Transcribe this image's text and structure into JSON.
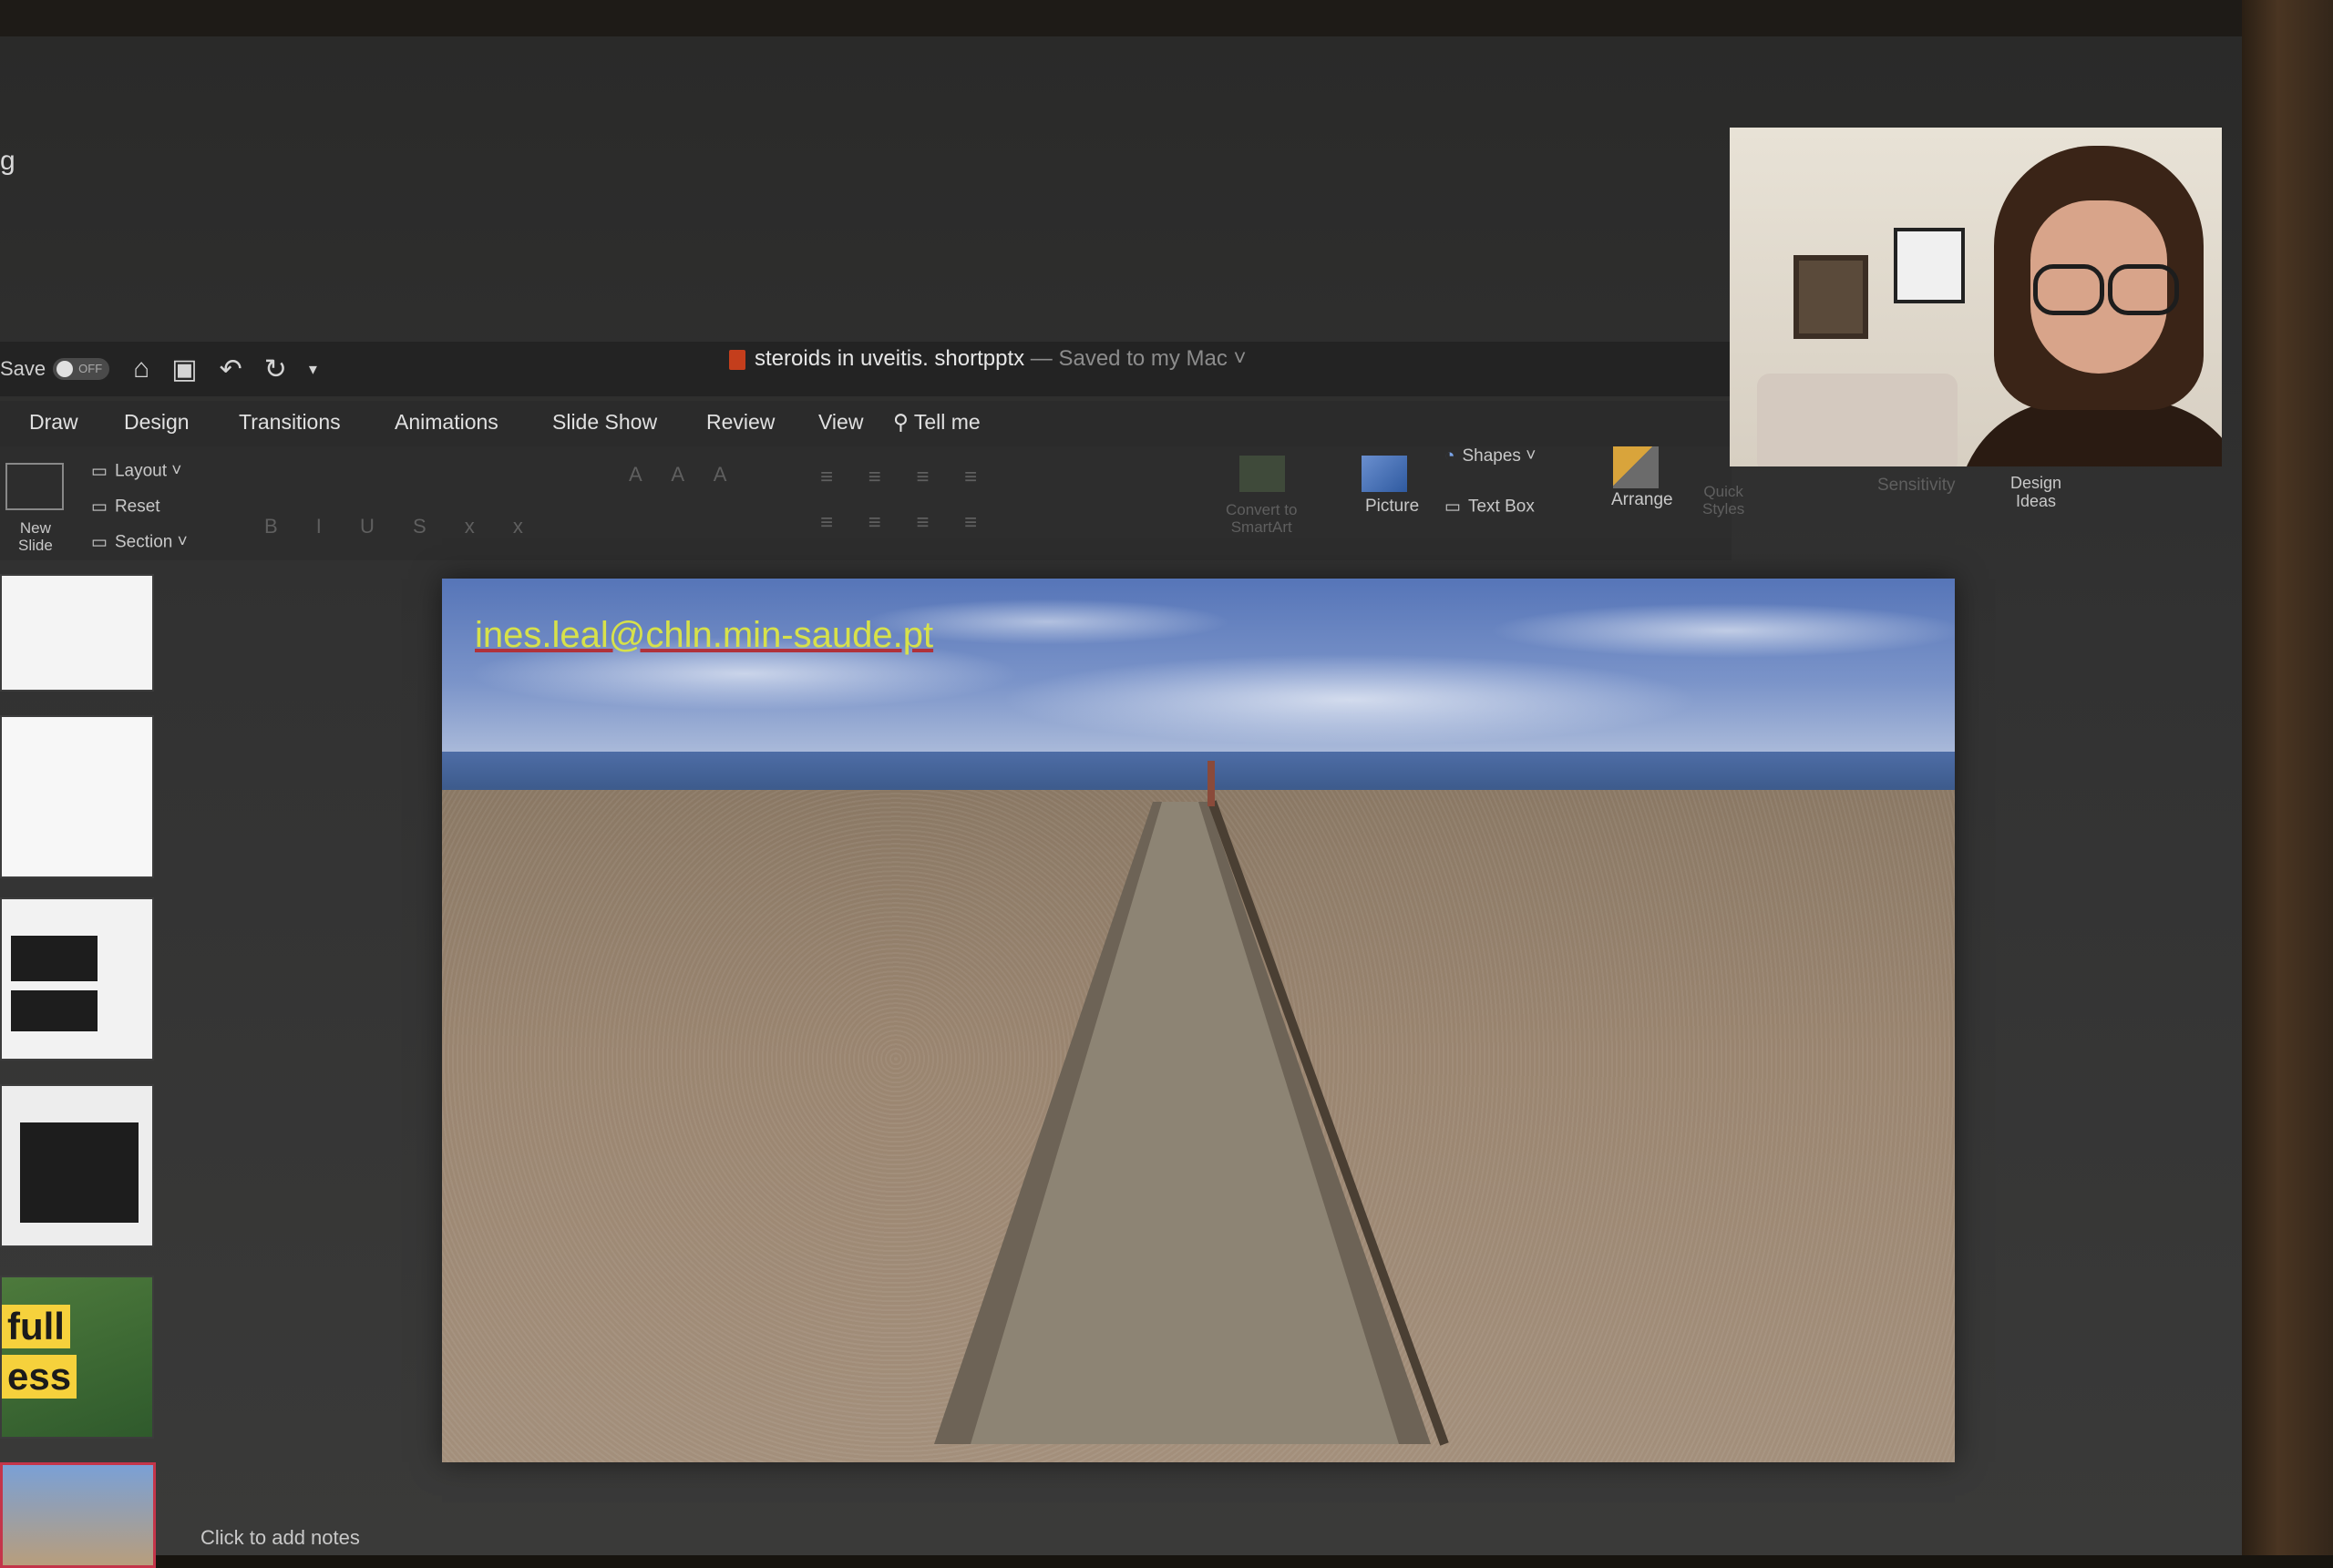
{
  "window": {
    "title_fragment": "g"
  },
  "titlebar": {
    "autosave_label": "Save",
    "autosave_state": "OFF",
    "doc_title": "steroids in uveitis. shortpptx",
    "doc_status": " — Saved to my Mac ˅"
  },
  "tabs": [
    {
      "label": "Draw"
    },
    {
      "label": "Design"
    },
    {
      "label": "Transitions"
    },
    {
      "label": "Animations"
    },
    {
      "label": "Slide Show"
    },
    {
      "label": "Review"
    },
    {
      "label": "View"
    },
    {
      "label": "Tell me"
    }
  ],
  "ribbon": {
    "new_slide": "New\nSlide",
    "layout": "Layout",
    "reset": "Reset",
    "section": "Section",
    "convert_smartart": "Convert to\nSmartArt",
    "picture": "Picture",
    "shapes": "Shapes",
    "text_box": "Text Box",
    "arrange": "Arrange",
    "quick_styles": "Quick\nStyles",
    "sensitivity": "Sensitivity",
    "design_ideas": "Design\nIdeas"
  },
  "thumbnails": {
    "sign_line1": "full",
    "sign_line2": "ess"
  },
  "slide": {
    "email": "ines.leal@chln.min-saude.pt"
  },
  "notes": {
    "placeholder": "Click to add notes"
  },
  "colors": {
    "email_text": "#d7e14a",
    "ppt_accent": "#c43e1c",
    "selected_thumb_border": "#c4354a"
  }
}
